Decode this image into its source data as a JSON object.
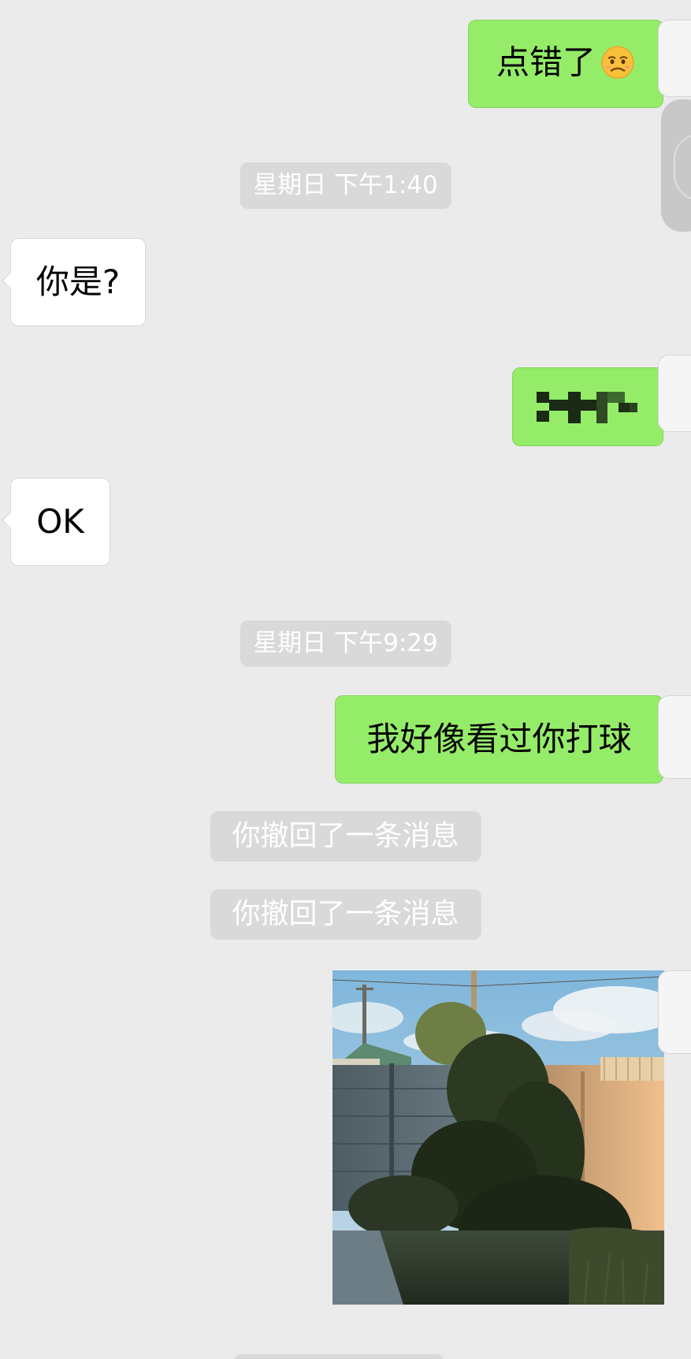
{
  "messages": {
    "m1": {
      "text": "点错了",
      "emoji": "worried-face-emoji"
    },
    "ts1": "星期日 下午1:40",
    "m2": "你是?",
    "m3": {
      "content": "blurred-mosaic"
    },
    "m4": "OK",
    "ts2": "星期日 下午9:29",
    "m5": "我好像看过你打球",
    "notice1": "你撤回了一条消息",
    "notice2": "你撤回了一条消息",
    "m6": {
      "type": "image",
      "subject": "fence and tree under blue sky"
    }
  },
  "colors": {
    "background": "#ebebeb",
    "outgoing_bubble": "#95ec69",
    "incoming_bubble": "#ffffff",
    "pill": "#d9d9d9"
  }
}
